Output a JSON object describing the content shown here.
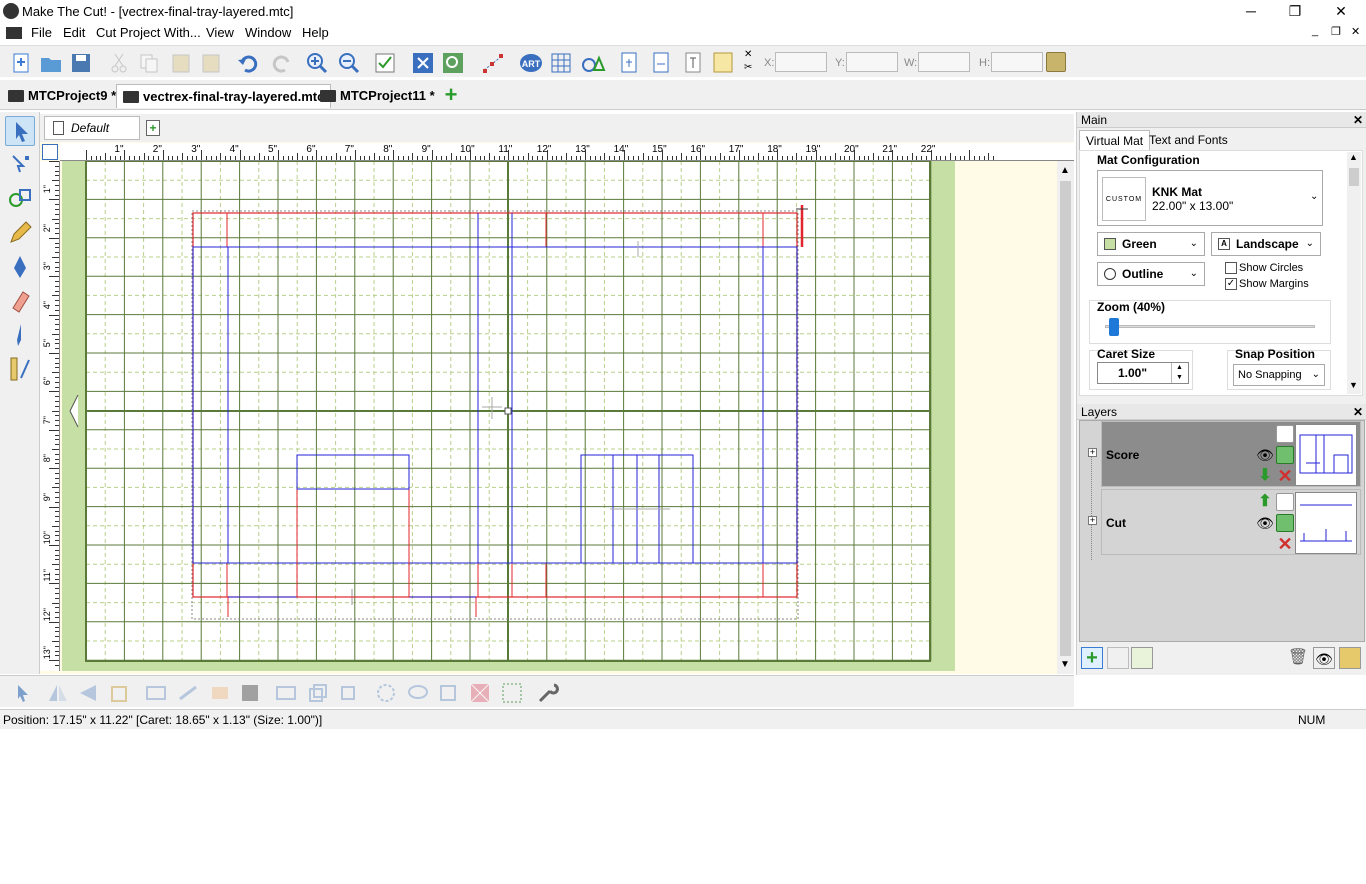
{
  "app": {
    "title": "Make The Cut! - [vectrex-final-tray-layered.mtc]"
  },
  "window_controls": {
    "minimize": "─",
    "restore": "❐",
    "close": "✕"
  },
  "menu": [
    "File",
    "Edit",
    "Cut Project With...",
    "View",
    "Window",
    "Help"
  ],
  "toolbar": {
    "x_label": "X:",
    "y_label": "Y:",
    "w_label": "W:",
    "h_label": "H:"
  },
  "tabs": [
    {
      "label": "MTCProject9 *",
      "active": false
    },
    {
      "label": "vectrex-final-tray-layered.mtc",
      "active": true
    },
    {
      "label": "MTCProject11 *",
      "active": false
    }
  ],
  "page_tab": {
    "label": "Default Page"
  },
  "ruler_top": [
    "1\"",
    "2\"",
    "3\"",
    "4\"",
    "5\"",
    "6\"",
    "7\"",
    "8\"",
    "9\"",
    "10\"",
    "11\"",
    "12\"",
    "13\"",
    "14\"",
    "15\"",
    "16\"",
    "17\"",
    "18\"",
    "19\"",
    "20\"",
    "21\"",
    "22\""
  ],
  "ruler_left": [
    "1\"",
    "2\"",
    "3\"",
    "4\"",
    "5\"",
    "6\"",
    "7\"",
    "8\"",
    "9\"",
    "10\"",
    "11\"",
    "12\"",
    "13\""
  ],
  "panel_main": {
    "header": "Main",
    "tabs": [
      "Virtual Mat",
      "Text and Fonts"
    ],
    "mat_config_label": "Mat Configuration",
    "mat_badge": "CUSTOM",
    "mat_name": "KNK Mat",
    "mat_size": "22.00\" x 13.00\"",
    "mat_color": "Green",
    "orientation": "Landscape",
    "render_mode": "Outline",
    "show_circles_label": "Show Circles",
    "show_circles": false,
    "show_margins_label": "Show Margins",
    "show_margins": true,
    "zoom_label": "Zoom (40%)",
    "zoom_level": 0.4,
    "caret_label": "Caret Size",
    "caret_value": "1.00\"",
    "snap_label": "Snap Position",
    "snap_value": "No Snapping"
  },
  "panel_layers": {
    "header": "Layers",
    "layers": [
      {
        "name": "Score",
        "selected": true
      },
      {
        "name": "Cut",
        "selected": false
      }
    ]
  },
  "status": {
    "text": "Position: 17.15\" x 11.22\" [Caret: 18.65\" x 1.13\" (Size: 1.00\")]",
    "num": "NUM"
  },
  "colors": {
    "mat_green": "#c6dfa4",
    "grid_line": "#5a7a3a",
    "cut_red": "#e0252c",
    "score_blue": "#2323d8",
    "canvas_bg": "#fffbe6"
  }
}
